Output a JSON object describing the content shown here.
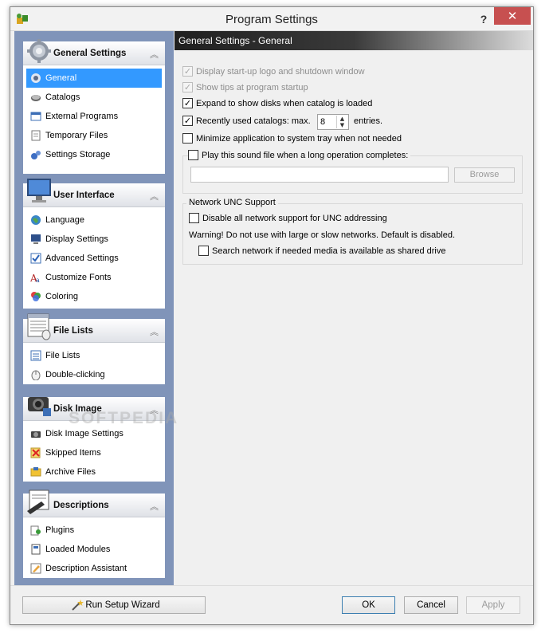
{
  "window": {
    "title": "Program Settings",
    "help_label": "?",
    "close_label": "✕"
  },
  "sidebar": {
    "groups": [
      {
        "title": "General Settings",
        "icon": "gear-icon",
        "items": [
          {
            "label": "General",
            "icon": "gear-small-icon",
            "selected": true
          },
          {
            "label": "Catalogs",
            "icon": "disk-icon"
          },
          {
            "label": "External Programs",
            "icon": "program-window-icon"
          },
          {
            "label": "Temporary Files",
            "icon": "document-icon"
          },
          {
            "label": "Settings Storage",
            "icon": "gears-icon"
          }
        ]
      },
      {
        "title": "User Interface",
        "icon": "monitor-icon",
        "items": [
          {
            "label": "Language",
            "icon": "globe-icon"
          },
          {
            "label": "Display Settings",
            "icon": "display-icon"
          },
          {
            "label": "Advanced Settings",
            "icon": "check-window-icon"
          },
          {
            "label": "Customize Fonts",
            "icon": "font-icon"
          },
          {
            "label": "Coloring",
            "icon": "palette-icon"
          }
        ]
      },
      {
        "title": "File Lists",
        "icon": "list-window-icon",
        "items": [
          {
            "label": "File Lists",
            "icon": "list-icon"
          },
          {
            "label": "Double-clicking",
            "icon": "mouse-icon"
          }
        ]
      },
      {
        "title": "Disk Image",
        "icon": "camera-icon",
        "items": [
          {
            "label": "Disk Image Settings",
            "icon": "camera-small-icon"
          },
          {
            "label": "Skipped Items",
            "icon": "skip-icon"
          },
          {
            "label": "Archive Files",
            "icon": "archive-icon"
          }
        ]
      },
      {
        "title": "Descriptions",
        "icon": "book-icon",
        "items": [
          {
            "label": "Plugins",
            "icon": "plugin-icon"
          },
          {
            "label": "Loaded Modules",
            "icon": "module-icon"
          },
          {
            "label": "Description Assistant",
            "icon": "pencil-icon"
          }
        ]
      }
    ]
  },
  "panel": {
    "header": "General Settings - General",
    "options": {
      "startup_logo": {
        "label": "Display start-up logo and shutdown window",
        "checked": true,
        "enabled": false
      },
      "show_tips": {
        "label": "Show tips at program startup",
        "checked": true,
        "enabled": false
      },
      "expand_disks": {
        "label": "Expand to show disks when catalog is loaded",
        "checked": true,
        "enabled": true
      },
      "recent_catalogs": {
        "label": "Recently used catalogs: max.",
        "checked": true,
        "enabled": true,
        "value": "8",
        "suffix": "entries."
      },
      "minimize_tray": {
        "label": "Minimize application to system tray when not needed",
        "checked": false,
        "enabled": true
      },
      "play_sound": {
        "label": "Play this sound file when a long operation completes:",
        "checked": false,
        "enabled": true
      }
    },
    "sound_file": {
      "value": ""
    },
    "browse_label": "Browse",
    "network": {
      "legend": "Network UNC Support",
      "disable_label": "Disable all network support for UNC addressing",
      "warning": "Warning! Do not use with large or slow networks. Default is disabled.",
      "search_label": "Search network if needed media is available as shared drive"
    }
  },
  "footer": {
    "wizard_label": "Run Setup Wizard",
    "ok_label": "OK",
    "cancel_label": "Cancel",
    "apply_label": "Apply"
  },
  "watermark": "SOFTPEDIA",
  "colors": {
    "sidebar_bg": "#8094b9",
    "selection": "#3399ff",
    "close_button": "#c75050"
  }
}
